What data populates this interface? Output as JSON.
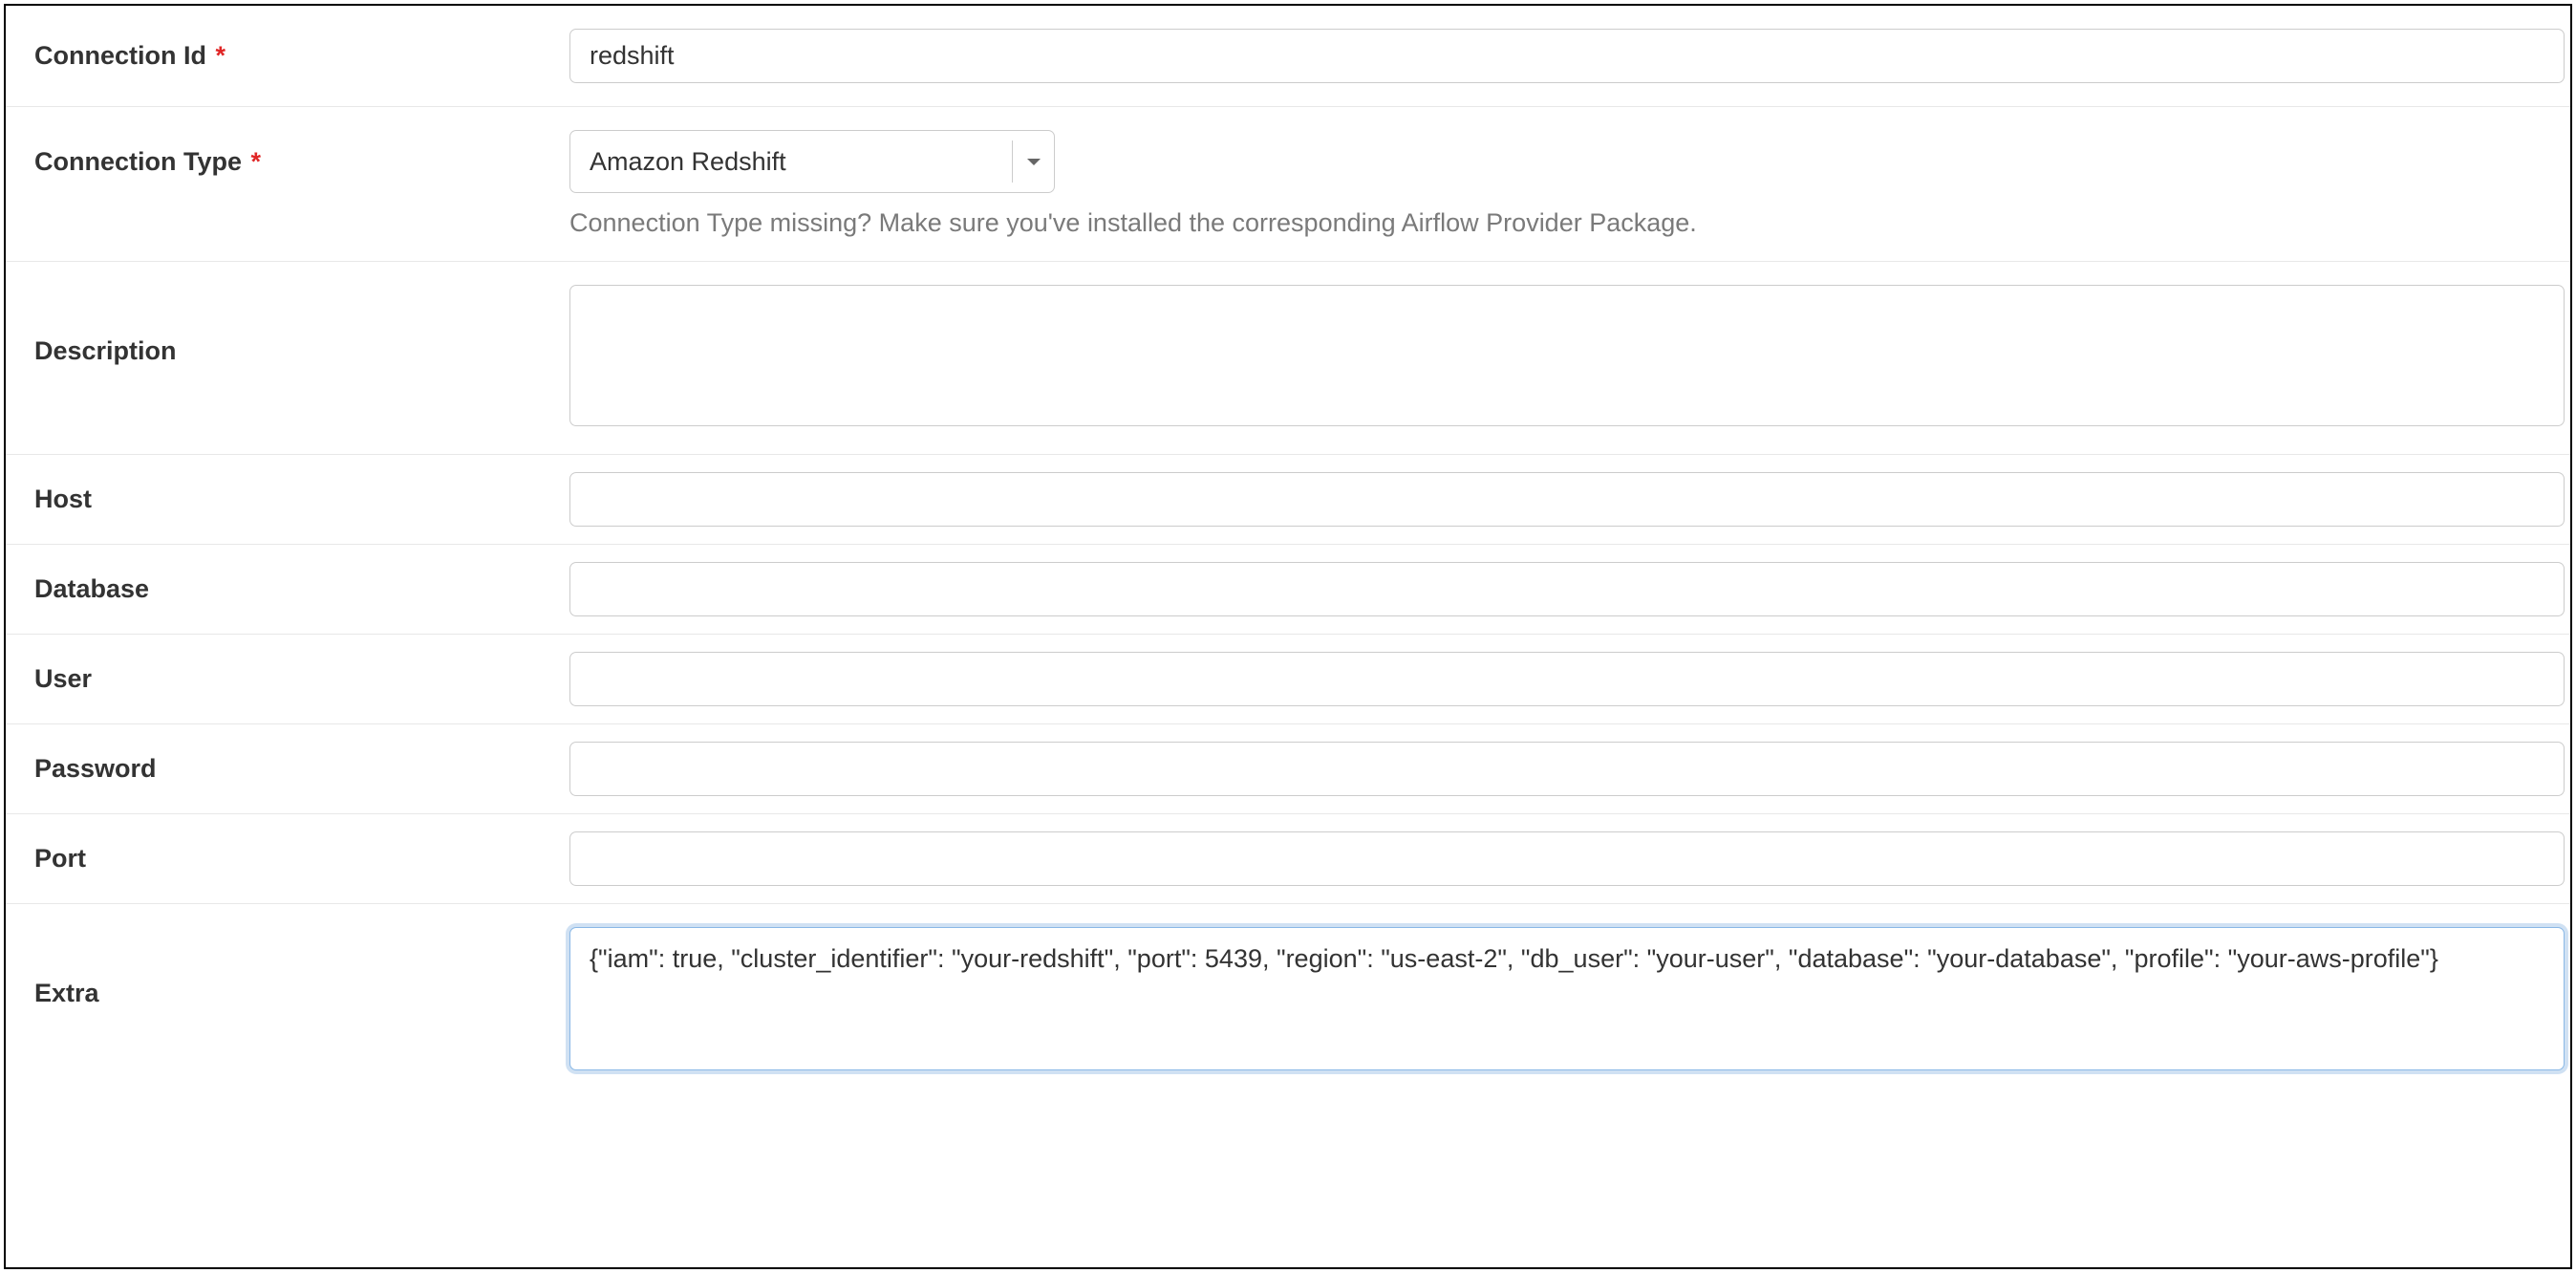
{
  "fields": {
    "connection_id": {
      "label": "Connection Id",
      "required": true,
      "value": "redshift"
    },
    "connection_type": {
      "label": "Connection Type",
      "required": true,
      "selected": "Amazon Redshift",
      "helper": "Connection Type missing? Make sure you've installed the corresponding Airflow Provider Package."
    },
    "description": {
      "label": "Description",
      "value": ""
    },
    "host": {
      "label": "Host",
      "value": ""
    },
    "database": {
      "label": "Database",
      "value": ""
    },
    "user": {
      "label": "User",
      "value": ""
    },
    "password": {
      "label": "Password",
      "value": ""
    },
    "port": {
      "label": "Port",
      "value": ""
    },
    "extra": {
      "label": "Extra",
      "value": "{\"iam\": true, \"cluster_identifier\": \"your-redshift\", \"port\": 5439, \"region\": \"us-east-2\", \"db_user\": \"your-user\", \"database\": \"your-database\", \"profile\": \"your-aws-profile\"}"
    }
  }
}
